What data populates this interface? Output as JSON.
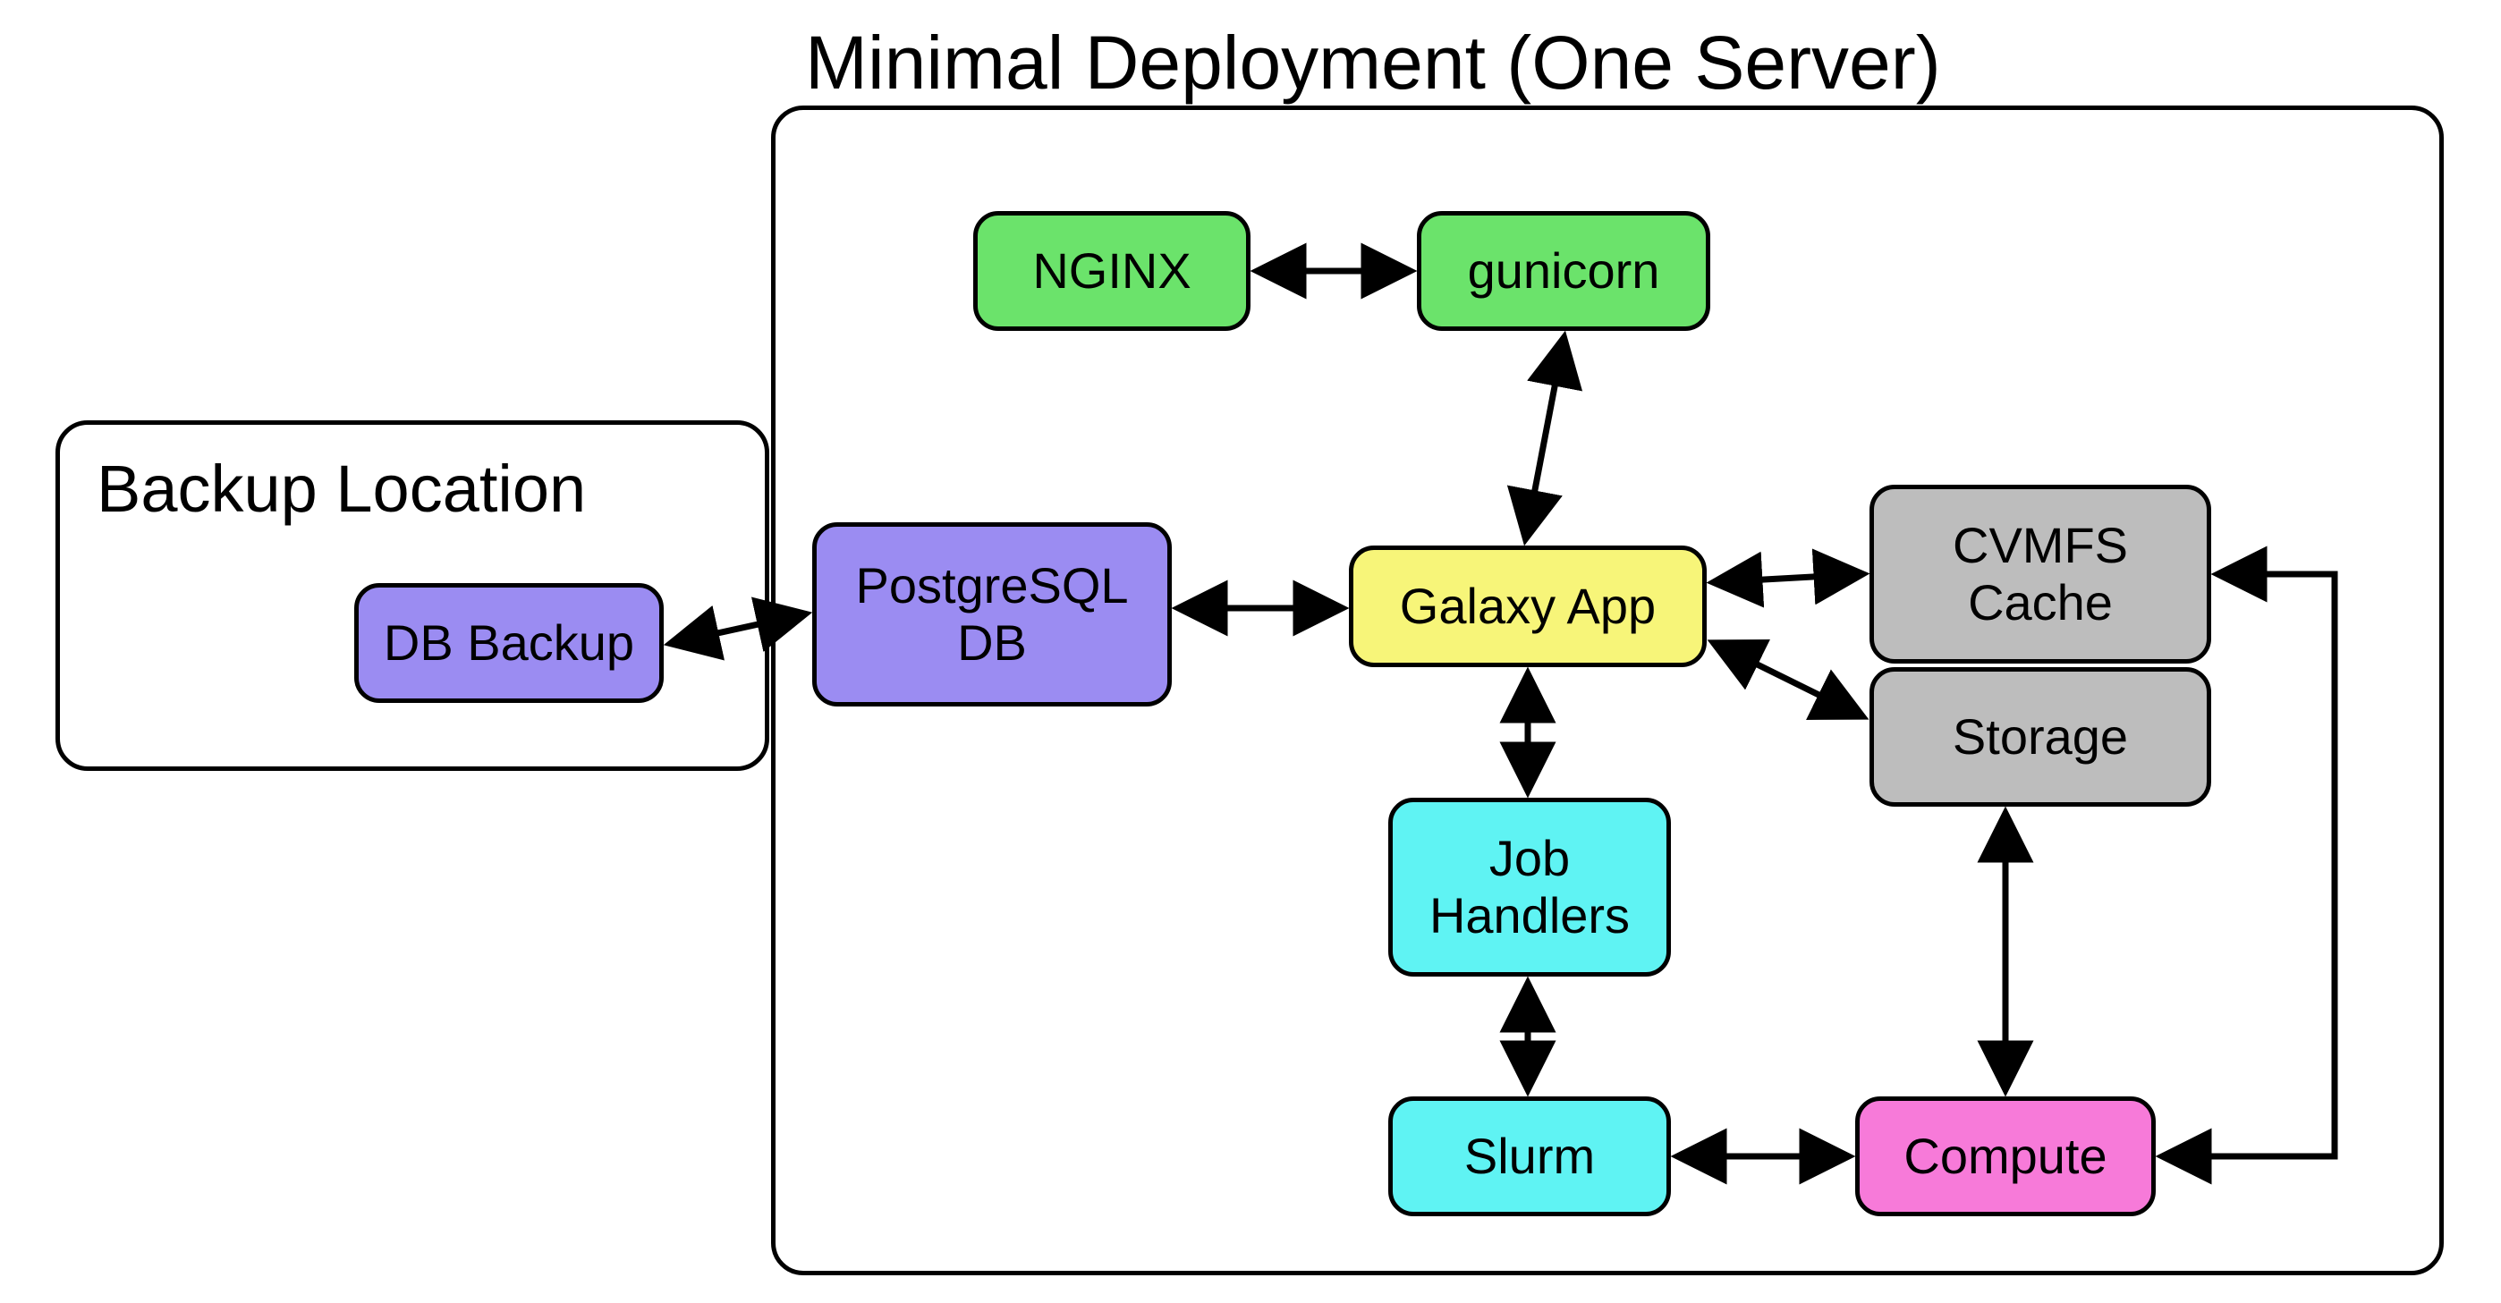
{
  "diagram": {
    "title_main": "Minimal Deployment (One Server)",
    "title_backup": "Backup Location",
    "nodes": {
      "nginx": "NGINX",
      "gunicorn": "gunicorn",
      "db_backup": "DB Backup",
      "postgres": "PostgreSQL DB",
      "galaxy": "Galaxy App",
      "cvmfs": "CVMFS Cache",
      "storage": "Storage",
      "job_handlers": "Job Handlers",
      "slurm": "Slurm",
      "compute": "Compute"
    }
  },
  "chart_data": {
    "type": "diagram",
    "containers": [
      {
        "id": "main",
        "label": "Minimal Deployment (One Server)",
        "children": [
          "nginx",
          "gunicorn",
          "postgres",
          "galaxy",
          "cvmfs",
          "storage",
          "job_handlers",
          "slurm",
          "compute"
        ]
      },
      {
        "id": "backup",
        "label": "Backup Location",
        "children": [
          "db_backup"
        ]
      }
    ],
    "nodes": [
      {
        "id": "nginx",
        "label": "NGINX",
        "color": "#6be36b"
      },
      {
        "id": "gunicorn",
        "label": "gunicorn",
        "color": "#6be36b"
      },
      {
        "id": "db_backup",
        "label": "DB Backup",
        "color": "#9b8cf2"
      },
      {
        "id": "postgres",
        "label": "PostgreSQL DB",
        "color": "#9b8cf2"
      },
      {
        "id": "galaxy",
        "label": "Galaxy App",
        "color": "#f7f579"
      },
      {
        "id": "cvmfs",
        "label": "CVMFS Cache",
        "color": "#bdbdbd"
      },
      {
        "id": "storage",
        "label": "Storage",
        "color": "#bdbdbd"
      },
      {
        "id": "job_handlers",
        "label": "Job Handlers",
        "color": "#5ff3f3"
      },
      {
        "id": "slurm",
        "label": "Slurm",
        "color": "#5ff3f3"
      },
      {
        "id": "compute",
        "label": "Compute",
        "color": "#f77ad9"
      }
    ],
    "edges": [
      {
        "from": "nginx",
        "to": "gunicorn",
        "bidirectional": true
      },
      {
        "from": "gunicorn",
        "to": "galaxy",
        "bidirectional": true
      },
      {
        "from": "db_backup",
        "to": "postgres",
        "bidirectional": true
      },
      {
        "from": "postgres",
        "to": "galaxy",
        "bidirectional": true
      },
      {
        "from": "galaxy",
        "to": "cvmfs",
        "bidirectional": true
      },
      {
        "from": "galaxy",
        "to": "storage",
        "bidirectional": true
      },
      {
        "from": "galaxy",
        "to": "job_handlers",
        "bidirectional": true
      },
      {
        "from": "job_handlers",
        "to": "slurm",
        "bidirectional": true
      },
      {
        "from": "slurm",
        "to": "compute",
        "bidirectional": true
      },
      {
        "from": "storage",
        "to": "compute",
        "bidirectional": true
      },
      {
        "from": "cvmfs",
        "to": "compute",
        "bidirectional": true
      }
    ]
  }
}
